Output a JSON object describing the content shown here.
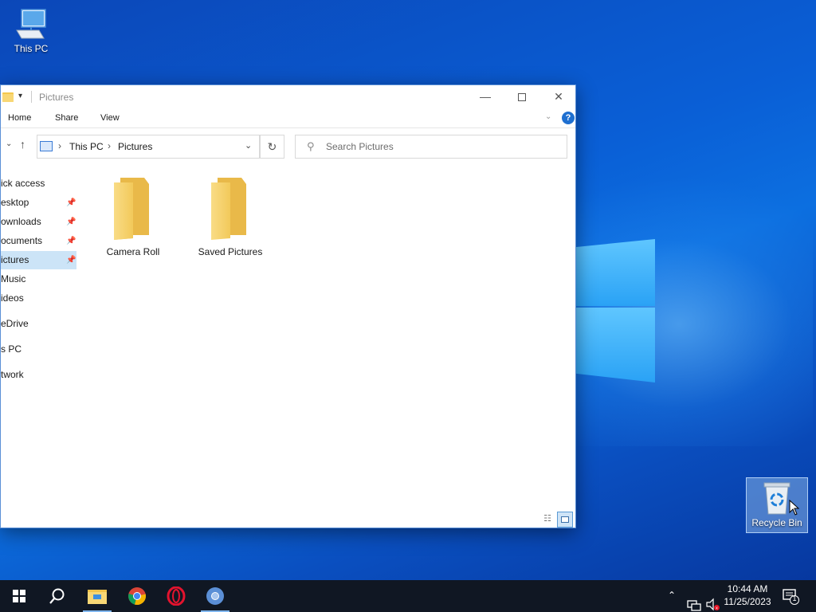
{
  "desktop": {
    "icons": [
      {
        "label": "This PC",
        "icon": "this-pc-icon"
      },
      {
        "label": "Recycle Bin",
        "icon": "recycle-bin-icon"
      }
    ]
  },
  "explorer": {
    "title": "Pictures",
    "ribbon_tabs": [
      "Home",
      "Share",
      "View"
    ],
    "help": "?",
    "address": {
      "segments": [
        "This PC",
        "Pictures"
      ]
    },
    "search": {
      "placeholder": "Search Pictures",
      "value": ""
    },
    "nav_items": [
      {
        "label": "ick access",
        "pinned": false
      },
      {
        "label": "esktop",
        "pinned": true
      },
      {
        "label": "ownloads",
        "pinned": true
      },
      {
        "label": "ocuments",
        "pinned": true
      },
      {
        "label": "ictures",
        "pinned": true,
        "selected": true
      },
      {
        "label": "Music",
        "pinned": false
      },
      {
        "label": "ideos",
        "pinned": false
      },
      {
        "label": "eDrive",
        "pinned": false
      },
      {
        "label": "s PC",
        "pinned": false
      },
      {
        "label": "twork",
        "pinned": false
      }
    ],
    "folders": [
      {
        "name": "Camera Roll"
      },
      {
        "name": "Saved Pictures"
      }
    ],
    "view_modes": [
      "details-view",
      "large-icons-view"
    ],
    "active_view": "large-icons-view"
  },
  "taskbar": {
    "apps": [
      "start",
      "search",
      "file-explorer",
      "chrome",
      "opera",
      "chromium"
    ],
    "active_apps": [
      "file-explorer",
      "chromium"
    ],
    "clock": {
      "time": "10:44 AM",
      "date": "11/25/2023"
    },
    "notification_count": "1"
  },
  "colors": {
    "accent": "#0078d7",
    "selection": "#cce4f7",
    "taskbar": "#101723",
    "folder": "#f8d775"
  }
}
